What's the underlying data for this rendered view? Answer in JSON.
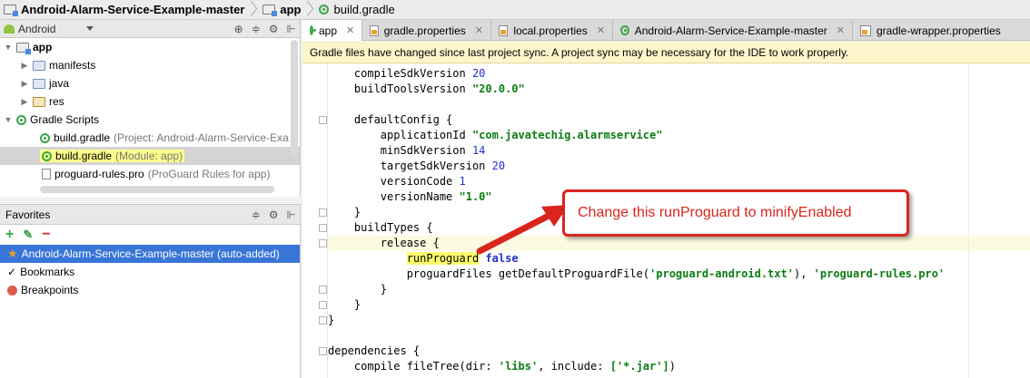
{
  "breadcrumb": {
    "project": "Android-Alarm-Service-Example-master",
    "module": "app",
    "file": "build.gradle"
  },
  "project_panel": {
    "view_mode": "Android",
    "tree": [
      {
        "label": "app",
        "hint": ""
      },
      {
        "label": "manifests",
        "hint": ""
      },
      {
        "label": "java",
        "hint": ""
      },
      {
        "label": "res",
        "hint": ""
      },
      {
        "label": "Gradle Scripts",
        "hint": ""
      },
      {
        "label": "build.gradle",
        "hint": "(Project: Android-Alarm-Service-Exa"
      },
      {
        "label": "build.gradle",
        "hint": "(Module: app)"
      },
      {
        "label": "proguard-rules.pro",
        "hint": "(ProGuard Rules for app)"
      }
    ]
  },
  "favorites_panel": {
    "title": "Favorites",
    "items": [
      {
        "label": "Android-Alarm-Service-Example-master (auto-added)"
      },
      {
        "label": "Bookmarks"
      },
      {
        "label": "Breakpoints"
      }
    ]
  },
  "tabs": [
    {
      "label": "app"
    },
    {
      "label": "gradle.properties"
    },
    {
      "label": "local.properties"
    },
    {
      "label": "Android-Alarm-Service-Example-master"
    },
    {
      "label": "gradle-wrapper.properties"
    }
  ],
  "notification": "Gradle files have changed since last project sync. A project sync may be necessary for the IDE to work properly.",
  "code": {
    "compile_sdk": "20",
    "build_tools": "\"20.0.0\"",
    "application_id": "\"com.javatechig.alarmservice\"",
    "min_sdk": "14",
    "target_sdk": "20",
    "version_code": "1",
    "version_name": "\"1.0\"",
    "run_proguard": "runProguard",
    "false_kw": "false",
    "proguard_android": "'proguard-android.txt'",
    "proguard_rules": "'proguard-rules.pro'",
    "libs": "'libs'",
    "jar": "['*.jar']"
  },
  "callout": "Change this runProguard to minifyEnabled",
  "colors": {
    "callout_red": "#d9251c",
    "selection_blue": "#3875d7",
    "notification_bg": "#fdf6cc"
  }
}
